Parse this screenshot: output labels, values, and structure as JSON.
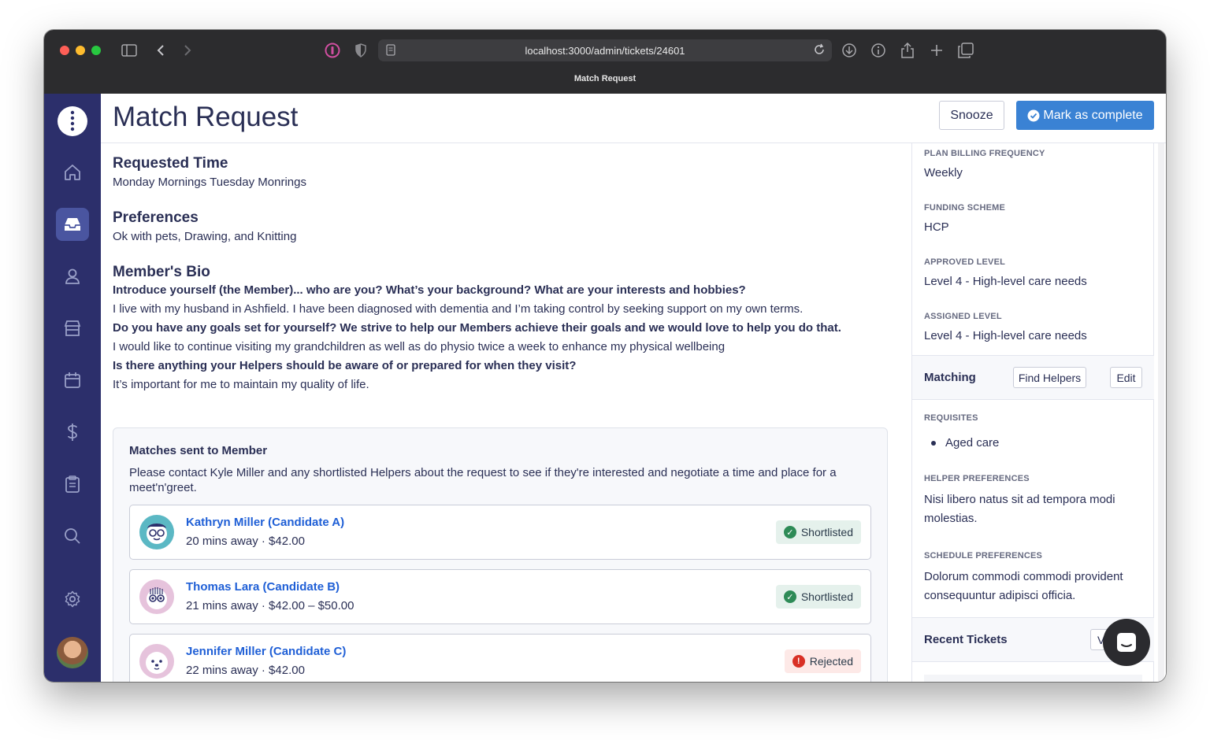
{
  "browser": {
    "url": "localhost:3000/admin/tickets/24601",
    "tab_title": "Match Request"
  },
  "header": {
    "title": "Match Request",
    "snooze_label": "Snooze",
    "complete_label": "Mark as complete"
  },
  "sidebar": {
    "items": [
      {
        "name": "home",
        "icon": "home-icon",
        "active": false
      },
      {
        "name": "inbox",
        "icon": "inbox-icon",
        "active": true
      },
      {
        "name": "members",
        "icon": "user-icon",
        "active": false
      },
      {
        "name": "store",
        "icon": "store-icon",
        "active": false
      },
      {
        "name": "calendar",
        "icon": "calendar-icon",
        "active": false
      },
      {
        "name": "billing",
        "icon": "dollar-icon",
        "active": false
      },
      {
        "name": "reports",
        "icon": "clipboard-icon",
        "active": false
      },
      {
        "name": "search",
        "icon": "search-icon",
        "active": false
      },
      {
        "name": "settings",
        "icon": "gear-icon",
        "active": false
      }
    ]
  },
  "request": {
    "requested_time_heading": "Requested Time",
    "requested_time": "Monday Mornings Tuesday Monrings",
    "preferences_heading": "Preferences",
    "preferences": "Ok with pets, Drawing, and Knitting",
    "bio_heading": "Member's Bio",
    "bio": [
      {
        "q": "Introduce yourself (the Member)... who are you? What’s your background? What are your interests and hobbies?",
        "a": "I live with my husband in Ashfield. I have been diagnosed with dementia and I’m taking control by seeking support on my own terms."
      },
      {
        "q": "Do you have any goals set for yourself? We strive to help our Members achieve their goals and we would love to help you do that.",
        "a": "I would like to continue visiting my grandchildren as well as do physio twice a week to enhance my physical wellbeing"
      },
      {
        "q": "Is there anything your Helpers should be aware of or prepared for when they visit?",
        "a": "It’s important for me to maintain my quality of life."
      }
    ]
  },
  "matches": {
    "title": "Matches sent to Member",
    "description": "Please contact Kyle Miller and any shortlisted Helpers about the request to see if they're interested and negotiate a time and place for a meet'n'greet.",
    "candidates": [
      {
        "name": "Kathryn Miller (Candidate A)",
        "meta": "20 mins away · $42.00",
        "status": "Shortlisted"
      },
      {
        "name": "Thomas Lara (Candidate B)",
        "meta": "21 mins away · $42.00 – $50.00",
        "status": "Shortlisted"
      },
      {
        "name": "Jennifer Miller (Candidate C)",
        "meta": "22 mins away · $42.00",
        "status": "Rejected"
      }
    ]
  },
  "details": {
    "billing_label": "PLAN BILLING FREQUENCY",
    "billing_value": "Weekly",
    "funding_label": "FUNDING SCHEME",
    "funding_value": "HCP",
    "approved_label": "APPROVED LEVEL",
    "approved_value": "Level 4 - High-level care needs",
    "assigned_label": "ASSIGNED LEVEL",
    "assigned_value": "Level 4 - High-level care needs"
  },
  "matching": {
    "title": "Matching",
    "find_helpers_label": "Find Helpers",
    "edit_label": "Edit",
    "requisites_label": "REQUISITES",
    "requisites": [
      "Aged care"
    ],
    "helper_prefs_label": "HELPER PREFERENCES",
    "helper_prefs_value": "Nisi libero natus sit ad tempora modi molestias.",
    "schedule_prefs_label": "SCHEDULE PREFERENCES",
    "schedule_prefs_value": "Dolorum commodi commodi provident consequuntur adipisci officia."
  },
  "recent_tickets": {
    "title": "Recent Tickets",
    "view_label": "V"
  },
  "colors": {
    "sidebar": "#2c2f6b",
    "accent": "#3a82d4",
    "link": "#1f5fd6",
    "success": "#2e8b57",
    "danger": "#d93025"
  }
}
